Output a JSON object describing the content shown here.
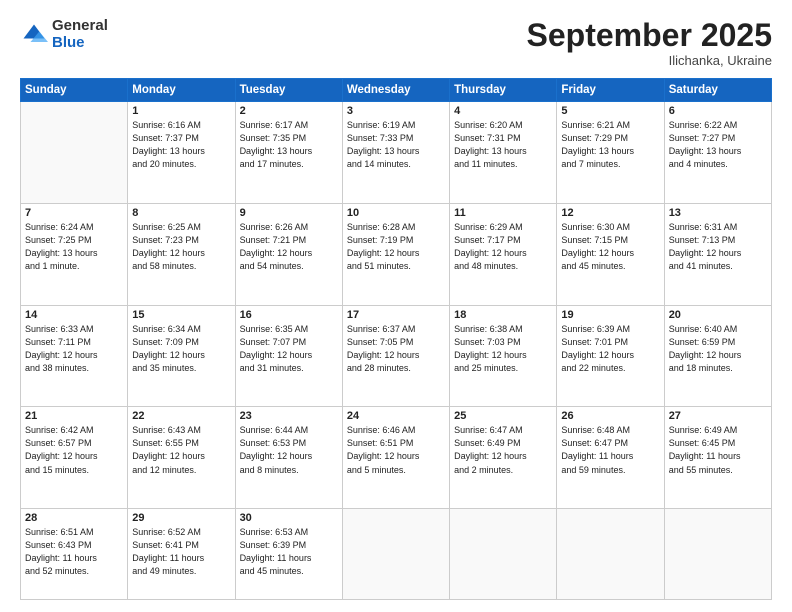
{
  "logo": {
    "general": "General",
    "blue": "Blue"
  },
  "header": {
    "month": "September 2025",
    "location": "Ilichanka, Ukraine"
  },
  "days_of_week": [
    "Sunday",
    "Monday",
    "Tuesday",
    "Wednesday",
    "Thursday",
    "Friday",
    "Saturday"
  ],
  "weeks": [
    [
      {
        "day": "",
        "info": ""
      },
      {
        "day": "1",
        "info": "Sunrise: 6:16 AM\nSunset: 7:37 PM\nDaylight: 13 hours\nand 20 minutes."
      },
      {
        "day": "2",
        "info": "Sunrise: 6:17 AM\nSunset: 7:35 PM\nDaylight: 13 hours\nand 17 minutes."
      },
      {
        "day": "3",
        "info": "Sunrise: 6:19 AM\nSunset: 7:33 PM\nDaylight: 13 hours\nand 14 minutes."
      },
      {
        "day": "4",
        "info": "Sunrise: 6:20 AM\nSunset: 7:31 PM\nDaylight: 13 hours\nand 11 minutes."
      },
      {
        "day": "5",
        "info": "Sunrise: 6:21 AM\nSunset: 7:29 PM\nDaylight: 13 hours\nand 7 minutes."
      },
      {
        "day": "6",
        "info": "Sunrise: 6:22 AM\nSunset: 7:27 PM\nDaylight: 13 hours\nand 4 minutes."
      }
    ],
    [
      {
        "day": "7",
        "info": "Sunrise: 6:24 AM\nSunset: 7:25 PM\nDaylight: 13 hours\nand 1 minute."
      },
      {
        "day": "8",
        "info": "Sunrise: 6:25 AM\nSunset: 7:23 PM\nDaylight: 12 hours\nand 58 minutes."
      },
      {
        "day": "9",
        "info": "Sunrise: 6:26 AM\nSunset: 7:21 PM\nDaylight: 12 hours\nand 54 minutes."
      },
      {
        "day": "10",
        "info": "Sunrise: 6:28 AM\nSunset: 7:19 PM\nDaylight: 12 hours\nand 51 minutes."
      },
      {
        "day": "11",
        "info": "Sunrise: 6:29 AM\nSunset: 7:17 PM\nDaylight: 12 hours\nand 48 minutes."
      },
      {
        "day": "12",
        "info": "Sunrise: 6:30 AM\nSunset: 7:15 PM\nDaylight: 12 hours\nand 45 minutes."
      },
      {
        "day": "13",
        "info": "Sunrise: 6:31 AM\nSunset: 7:13 PM\nDaylight: 12 hours\nand 41 minutes."
      }
    ],
    [
      {
        "day": "14",
        "info": "Sunrise: 6:33 AM\nSunset: 7:11 PM\nDaylight: 12 hours\nand 38 minutes."
      },
      {
        "day": "15",
        "info": "Sunrise: 6:34 AM\nSunset: 7:09 PM\nDaylight: 12 hours\nand 35 minutes."
      },
      {
        "day": "16",
        "info": "Sunrise: 6:35 AM\nSunset: 7:07 PM\nDaylight: 12 hours\nand 31 minutes."
      },
      {
        "day": "17",
        "info": "Sunrise: 6:37 AM\nSunset: 7:05 PM\nDaylight: 12 hours\nand 28 minutes."
      },
      {
        "day": "18",
        "info": "Sunrise: 6:38 AM\nSunset: 7:03 PM\nDaylight: 12 hours\nand 25 minutes."
      },
      {
        "day": "19",
        "info": "Sunrise: 6:39 AM\nSunset: 7:01 PM\nDaylight: 12 hours\nand 22 minutes."
      },
      {
        "day": "20",
        "info": "Sunrise: 6:40 AM\nSunset: 6:59 PM\nDaylight: 12 hours\nand 18 minutes."
      }
    ],
    [
      {
        "day": "21",
        "info": "Sunrise: 6:42 AM\nSunset: 6:57 PM\nDaylight: 12 hours\nand 15 minutes."
      },
      {
        "day": "22",
        "info": "Sunrise: 6:43 AM\nSunset: 6:55 PM\nDaylight: 12 hours\nand 12 minutes."
      },
      {
        "day": "23",
        "info": "Sunrise: 6:44 AM\nSunset: 6:53 PM\nDaylight: 12 hours\nand 8 minutes."
      },
      {
        "day": "24",
        "info": "Sunrise: 6:46 AM\nSunset: 6:51 PM\nDaylight: 12 hours\nand 5 minutes."
      },
      {
        "day": "25",
        "info": "Sunrise: 6:47 AM\nSunset: 6:49 PM\nDaylight: 12 hours\nand 2 minutes."
      },
      {
        "day": "26",
        "info": "Sunrise: 6:48 AM\nSunset: 6:47 PM\nDaylight: 11 hours\nand 59 minutes."
      },
      {
        "day": "27",
        "info": "Sunrise: 6:49 AM\nSunset: 6:45 PM\nDaylight: 11 hours\nand 55 minutes."
      }
    ],
    [
      {
        "day": "28",
        "info": "Sunrise: 6:51 AM\nSunset: 6:43 PM\nDaylight: 11 hours\nand 52 minutes."
      },
      {
        "day": "29",
        "info": "Sunrise: 6:52 AM\nSunset: 6:41 PM\nDaylight: 11 hours\nand 49 minutes."
      },
      {
        "day": "30",
        "info": "Sunrise: 6:53 AM\nSunset: 6:39 PM\nDaylight: 11 hours\nand 45 minutes."
      },
      {
        "day": "",
        "info": ""
      },
      {
        "day": "",
        "info": ""
      },
      {
        "day": "",
        "info": ""
      },
      {
        "day": "",
        "info": ""
      }
    ]
  ]
}
